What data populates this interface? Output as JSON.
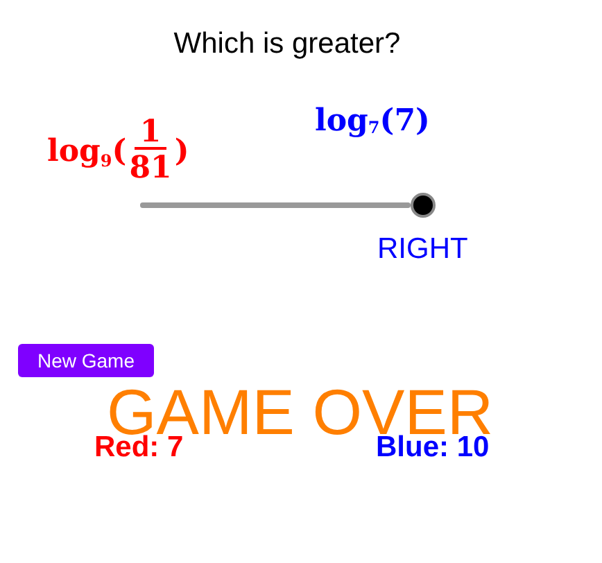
{
  "title": "Which is greater?",
  "left_expression": {
    "name": "log",
    "base": "9",
    "open": "(",
    "numerator": "1",
    "denominator": "81",
    "close": ")"
  },
  "right_expression": {
    "name": "log",
    "base": "7",
    "argument": "(7)"
  },
  "slider": {
    "level": 1,
    "label": "RIGHT"
  },
  "new_game_button": "New Game",
  "message": "GAME OVER",
  "scores": [
    {
      "label": "Red: 7",
      "color": "#ff0000"
    },
    {
      "label": "Blue: 10",
      "color": "#0000ff"
    }
  ]
}
